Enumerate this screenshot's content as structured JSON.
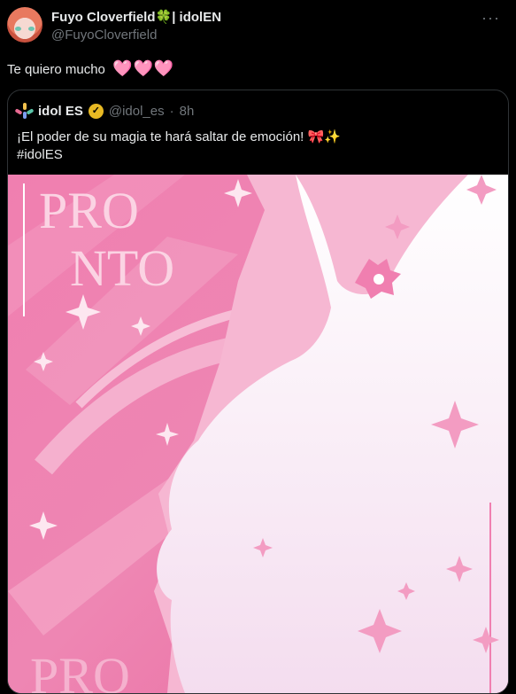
{
  "tweet": {
    "display_name": "Fuyo Cloverfield🍀| idolEN",
    "handle": "@FuyoCloverfield",
    "more_icon": "more-icon",
    "text": "Te quiero mucho",
    "hearts": "🩷🩷🩷"
  },
  "quote": {
    "name": "idol ES",
    "handle": "@idol_es",
    "separator": "·",
    "time": "8h",
    "text_line1": "¡El poder de su magia te hará saltar de emoción! 🎀✨",
    "text_line2": "#idolES",
    "media": {
      "title_line1": "PRO",
      "title_line2": "NTO",
      "title_bottom": "PRO"
    }
  },
  "colors": {
    "background": "#000000",
    "text": "#e7e9ea",
    "muted": "#71767b",
    "pink": "#ee7fad",
    "verified": "#e8b923"
  }
}
